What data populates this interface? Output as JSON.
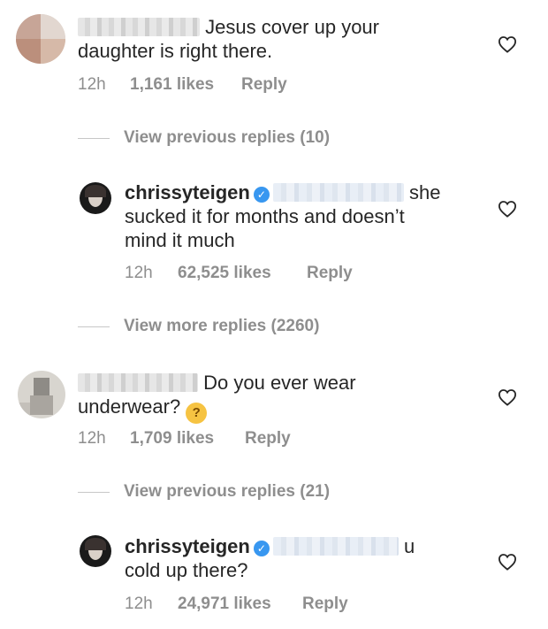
{
  "comments": [
    {
      "text": "Jesus cover up your daughter is right there.",
      "line1": "Jesus cover up your",
      "line2": "daughter is right there.",
      "time": "12h",
      "likes": "1,161 likes",
      "reply": "Reply"
    },
    {
      "text": "Do you ever wear underwear?",
      "line1": "Do you ever wear",
      "line2": "underwear?",
      "emoji": "thinking-face-emoji",
      "time": "12h",
      "likes": "1,709 likes",
      "reply": "Reply"
    }
  ],
  "view_replies": [
    "View previous replies (10)",
    "View more replies (2260)",
    "View previous replies (21)"
  ],
  "replies": [
    {
      "username": "chrissyteigen",
      "verified": true,
      "text": "she sucked it for months and doesn’t mind it much",
      "line1_end": "she",
      "line2": "sucked it for months and doesn’t",
      "line3": "mind it much",
      "time": "12h",
      "likes": "62,525 likes",
      "reply": "Reply"
    },
    {
      "username": "chrissyteigen",
      "verified": true,
      "text": "u cold up there?",
      "line1_end": "u",
      "line2": "cold up there?",
      "time": "12h",
      "likes": "24,971 likes",
      "reply": "Reply"
    }
  ],
  "icons": {
    "like": "heart-outline-icon",
    "verified": "verified-badge-icon"
  },
  "colors": {
    "text": "#262626",
    "muted": "#8e8e8e",
    "verified": "#3897f0"
  }
}
